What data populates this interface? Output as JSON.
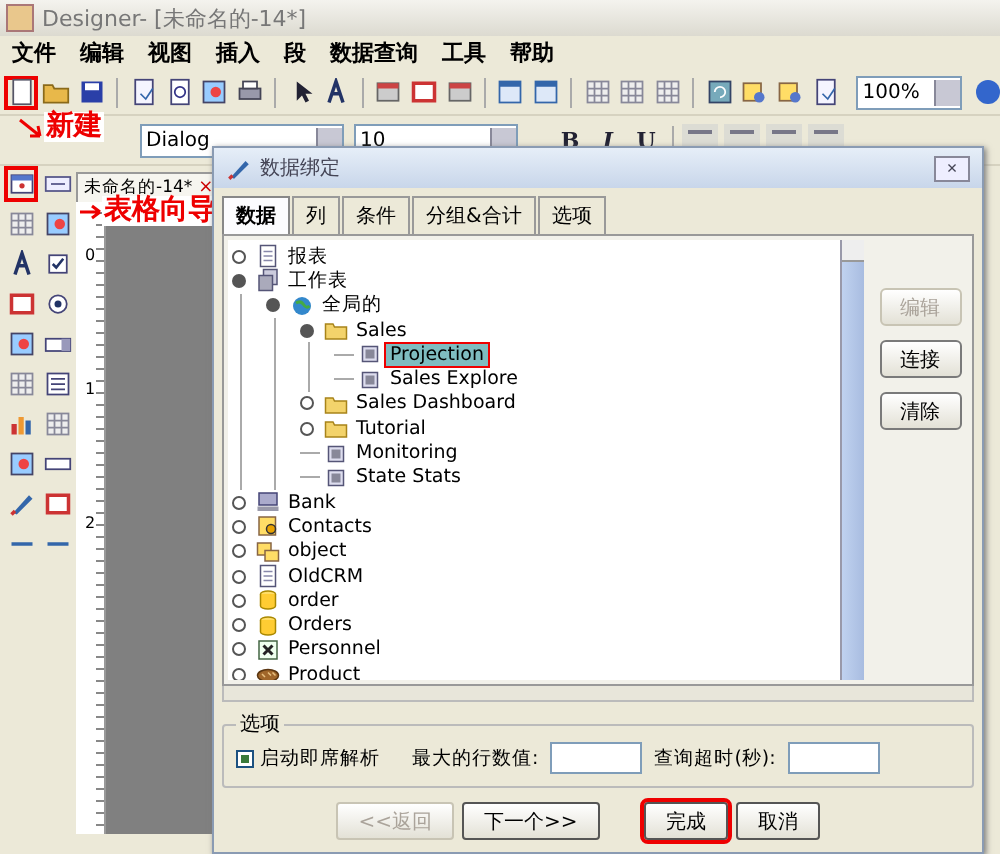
{
  "window": {
    "title": "Designer- [未命名的-14*]"
  },
  "menu": [
    "文件",
    "编辑",
    "视图",
    "插入",
    "段",
    "数据查询",
    "工具",
    "帮助"
  ],
  "toolbar": {
    "buttons": [
      {
        "kind": "new",
        "highlighted": true
      },
      {
        "kind": "open",
        "highlighted": false
      },
      {
        "kind": "save",
        "highlighted": false
      },
      {
        "kind": "sep"
      },
      {
        "kind": "page",
        "highlighted": false
      },
      {
        "kind": "preview",
        "highlighted": false
      },
      {
        "kind": "image",
        "highlighted": false
      },
      {
        "kind": "print",
        "highlighted": false
      },
      {
        "kind": "sep"
      },
      {
        "kind": "pointer",
        "highlighted": false
      },
      {
        "kind": "text",
        "highlighted": false
      },
      {
        "kind": "sep"
      },
      {
        "kind": "band",
        "highlighted": false
      },
      {
        "kind": "frame",
        "highlighted": false
      },
      {
        "kind": "band",
        "highlighted": false
      },
      {
        "kind": "sep"
      },
      {
        "kind": "window",
        "highlighted": false
      },
      {
        "kind": "window",
        "highlighted": false
      },
      {
        "kind": "sep"
      },
      {
        "kind": "grid",
        "highlighted": false
      },
      {
        "kind": "grid",
        "highlighted": false
      },
      {
        "kind": "grid",
        "highlighted": false
      },
      {
        "kind": "sep"
      },
      {
        "kind": "refresh",
        "highlighted": false
      },
      {
        "kind": "query",
        "highlighted": false
      },
      {
        "kind": "query",
        "highlighted": false
      },
      {
        "kind": "page",
        "highlighted": false
      }
    ],
    "zoom": "100%"
  },
  "format_bar": {
    "font": "Dialog",
    "size": "10",
    "bold": "B",
    "italic": "I",
    "underline": "U"
  },
  "palette": [
    {
      "kind": "table",
      "highlighted": true
    },
    {
      "kind": "ok",
      "highlighted": false
    },
    {
      "kind": "grid",
      "highlighted": false
    },
    {
      "kind": "image",
      "highlighted": false
    },
    {
      "kind": "text",
      "highlighted": false
    },
    {
      "kind": "check",
      "highlighted": false
    },
    {
      "kind": "frame",
      "highlighted": false
    },
    {
      "kind": "radio",
      "highlighted": false
    },
    {
      "kind": "image",
      "highlighted": false
    },
    {
      "kind": "combo",
      "highlighted": false
    },
    {
      "kind": "grid",
      "highlighted": false
    },
    {
      "kind": "list",
      "highlighted": false
    },
    {
      "kind": "chart",
      "highlighted": false
    },
    {
      "kind": "grid",
      "highlighted": false
    },
    {
      "kind": "image",
      "highlighted": false
    },
    {
      "kind": "field",
      "highlighted": false
    },
    {
      "kind": "pen",
      "highlighted": false
    },
    {
      "kind": "frame",
      "highlighted": false
    },
    {
      "kind": "line",
      "highlighted": false
    },
    {
      "kind": "line",
      "highlighted": false
    }
  ],
  "document": {
    "tab": "未命名的-14*",
    "close": "×",
    "ruler": [
      "0",
      "1",
      "2"
    ]
  },
  "annotations": [
    {
      "text": "新建"
    },
    {
      "text": "表格向导"
    }
  ],
  "dialog": {
    "title": "数据绑定",
    "close": "×",
    "tabs": [
      {
        "label": "数据",
        "selected": true
      },
      {
        "label": "列",
        "selected": false
      },
      {
        "label": "条件",
        "selected": false
      },
      {
        "label": "分组&合计",
        "selected": false
      },
      {
        "label": "选项",
        "selected": false
      }
    ],
    "tree": [
      {
        "label": "报表",
        "kind": "report",
        "expanded": false,
        "selected": false
      },
      {
        "label": "工作表",
        "kind": "sheet",
        "expanded": true,
        "selected": false,
        "children": [
          {
            "label": "全局的",
            "kind": "globe",
            "expanded": true,
            "selected": false,
            "children": [
              {
                "label": "Sales",
                "kind": "folder",
                "expanded": true,
                "selected": false,
                "children": [
                  {
                    "label": "Projection",
                    "kind": "item",
                    "selected": true
                  },
                  {
                    "label": "Sales Explore",
                    "kind": "item",
                    "selected": false
                  }
                ]
              },
              {
                "label": "Sales Dashboard",
                "kind": "folder",
                "expanded": false,
                "selected": false
              },
              {
                "label": "Tutorial",
                "kind": "folder",
                "expanded": false,
                "selected": false
              },
              {
                "label": "Monitoring",
                "kind": "item",
                "selected": false
              },
              {
                "label": "State Stats",
                "kind": "item",
                "selected": false
              }
            ]
          }
        ]
      },
      {
        "label": "Bank",
        "kind": "computer",
        "expanded": false,
        "selected": false
      },
      {
        "label": "Contacts",
        "kind": "contacts",
        "expanded": false,
        "selected": false
      },
      {
        "label": "object",
        "kind": "object",
        "expanded": false,
        "selected": false
      },
      {
        "label": "OldCRM",
        "kind": "report",
        "expanded": false,
        "selected": false
      },
      {
        "label": "order",
        "kind": "database",
        "expanded": false,
        "selected": false
      },
      {
        "label": "Orders",
        "kind": "database",
        "expanded": false,
        "selected": false
      },
      {
        "label": "Personnel",
        "kind": "excel",
        "expanded": false,
        "selected": false
      },
      {
        "label": "Product",
        "kind": "product",
        "expanded": false,
        "selected": false
      }
    ],
    "side_buttons": [
      {
        "label": "编辑",
        "disabled": true
      },
      {
        "label": "连接",
        "disabled": false
      },
      {
        "label": "清除",
        "disabled": false
      }
    ],
    "options": {
      "legend": "选项",
      "checkbox": {
        "label": "启动即席解析",
        "checked": true
      },
      "max_rows_label": "最大的行数值:",
      "timeout_label": "查询超时(秒):"
    },
    "buttons": [
      {
        "label": "<<返回",
        "disabled": true,
        "highlighted": false
      },
      {
        "label": "下一个>>",
        "disabled": false,
        "highlighted": false
      },
      {
        "label": "完成",
        "disabled": false,
        "highlighted": true
      },
      {
        "label": "取消",
        "disabled": false,
        "highlighted": false
      }
    ]
  }
}
